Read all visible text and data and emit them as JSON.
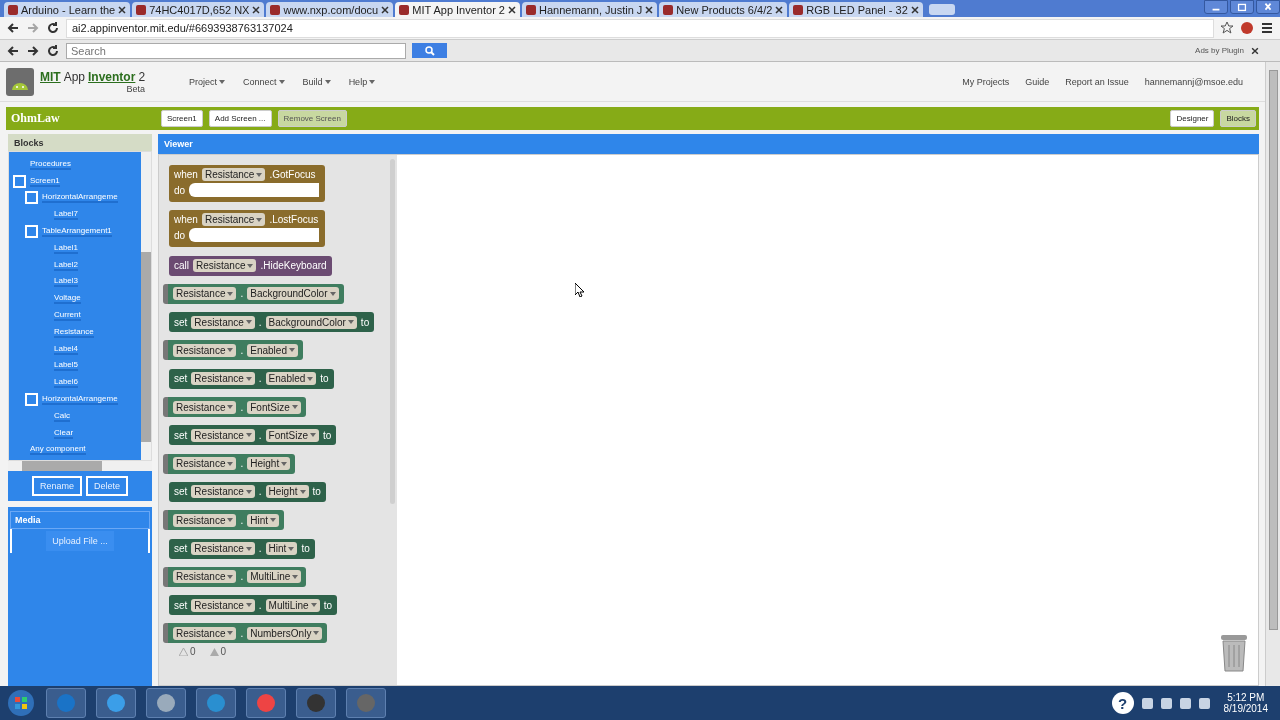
{
  "browser": {
    "tabs": [
      {
        "title": "Arduino - Learn the",
        "selected": false
      },
      {
        "title": "74HC4017D,652 NX",
        "selected": false
      },
      {
        "title": "www.nxp.com/docu",
        "selected": false
      },
      {
        "title": "MIT App Inventor 2",
        "selected": true
      },
      {
        "title": "Hannemann, Justin J",
        "selected": false
      },
      {
        "title": "New Products 6/4/2",
        "selected": false
      },
      {
        "title": "RGB LED Panel - 32",
        "selected": false
      }
    ],
    "url": "ai2.appinventor.mit.edu/#6693938763137024",
    "search": {
      "placeholder": "Search"
    },
    "ads_label": "Ads by Plugin"
  },
  "header": {
    "logo": {
      "part1": "MIT",
      "part2": "App",
      "part3": "Inventor",
      "part4": "2",
      "beta": "Beta"
    },
    "menus": [
      "Project",
      "Connect",
      "Build",
      "Help"
    ],
    "links": [
      "My Projects",
      "Guide",
      "Report an Issue"
    ],
    "account": "hannemannj@msoe.edu"
  },
  "toolbar": {
    "project": "OhmLaw",
    "screen": "Screen1",
    "buttons": [
      {
        "label": "Add Screen ...",
        "disabled": false
      },
      {
        "label": "Remove Screen",
        "disabled": true
      }
    ],
    "views": [
      {
        "label": "Designer",
        "selected": false
      },
      {
        "label": "Blocks",
        "selected": true
      }
    ]
  },
  "blocks_panel": {
    "title": "Blocks",
    "tree": [
      {
        "label": "Procedures"
      },
      {
        "label": "Screen1",
        "children": [
          {
            "label": "HorizontalArrangeme",
            "children": [
              {
                "label": "Label7"
              }
            ]
          },
          {
            "label": "TableArrangement1",
            "children": [
              {
                "label": "Label1"
              },
              {
                "label": "Label2"
              },
              {
                "label": "Label3"
              },
              {
                "label": "Voltage"
              },
              {
                "label": "Current"
              },
              {
                "label": "Resistance"
              },
              {
                "label": "Label4"
              },
              {
                "label": "Label5"
              },
              {
                "label": "Label6"
              }
            ]
          },
          {
            "label": "HorizontalArrangeme",
            "children": [
              {
                "label": "Calc"
              },
              {
                "label": "Clear"
              }
            ]
          }
        ]
      },
      {
        "label": "Any component"
      }
    ],
    "buttons": [
      "Rename",
      "Delete"
    ]
  },
  "media": {
    "title": "Media",
    "button": "Upload File ..."
  },
  "viewer": {
    "title": "Viewer",
    "blocks": [
      {
        "kind": "event",
        "keyword": "when",
        "component": "Resistance",
        "member": ".GotFocus",
        "do": "do"
      },
      {
        "kind": "event",
        "keyword": "when",
        "component": "Resistance",
        "member": ".LostFocus",
        "do": "do"
      },
      {
        "kind": "call",
        "keyword": "call",
        "component": "Resistance",
        "member": ".HideKeyboard"
      },
      {
        "kind": "getter",
        "component": "Resistance",
        "dot": ".",
        "member": "BackgroundColor"
      },
      {
        "kind": "setter",
        "keyword": "set",
        "component": "Resistance",
        "dot": ".",
        "member": "BackgroundColor",
        "to": "to"
      },
      {
        "kind": "getter",
        "component": "Resistance",
        "dot": ".",
        "member": "Enabled"
      },
      {
        "kind": "setter",
        "keyword": "set",
        "component": "Resistance",
        "dot": ".",
        "member": "Enabled",
        "to": "to"
      },
      {
        "kind": "getter",
        "component": "Resistance",
        "dot": ".",
        "member": "FontSize"
      },
      {
        "kind": "setter",
        "keyword": "set",
        "component": "Resistance",
        "dot": ".",
        "member": "FontSize",
        "to": "to"
      },
      {
        "kind": "getter",
        "component": "Resistance",
        "dot": ".",
        "member": "Height"
      },
      {
        "kind": "setter",
        "keyword": "set",
        "component": "Resistance",
        "dot": ".",
        "member": "Height",
        "to": "to"
      },
      {
        "kind": "getter",
        "component": "Resistance",
        "dot": ".",
        "member": "Hint"
      },
      {
        "kind": "setter",
        "keyword": "set",
        "component": "Resistance",
        "dot": ".",
        "member": "Hint",
        "to": "to"
      },
      {
        "kind": "getter",
        "component": "Resistance",
        "dot": ".",
        "member": "MultiLine"
      },
      {
        "kind": "setter",
        "keyword": "set",
        "component": "Resistance",
        "dot": ".",
        "member": "MultiLine",
        "to": "to"
      },
      {
        "kind": "getter",
        "component": "Resistance",
        "dot": ".",
        "member": "NumbersOnly"
      }
    ],
    "warnings": "0",
    "errors": "0"
  },
  "taskbar": {
    "time": "5:12 PM",
    "date": "8/19/2014",
    "help": "?"
  }
}
